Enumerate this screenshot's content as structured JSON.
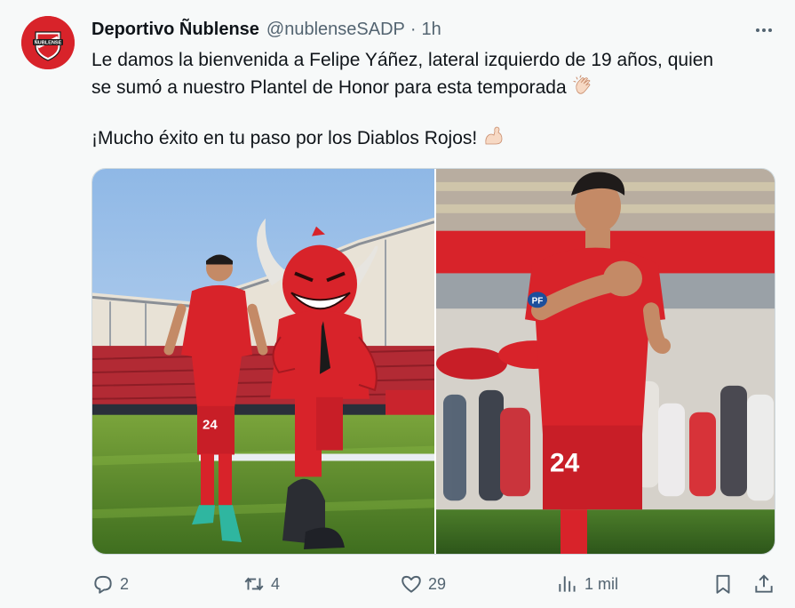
{
  "account": {
    "name": "Deportivo Ñublense",
    "handle": "@nublenseSADP",
    "separator": "·",
    "time": "1h",
    "avatar_text": "ÑUBLENSE"
  },
  "tweet": {
    "line1": "Le damos la bienvenida a Felipe Yáñez, lateral izquierdo de 19 años, quien",
    "line2": "se sumó a nuestro Plantel de Honor para esta temporada",
    "line3": "¡Mucho éxito en tu paso por los Diablos Rojos!",
    "emoji1": "clapping-hands",
    "emoji2": "flexed-biceps"
  },
  "media": {
    "photo1": {
      "jersey_number": "24"
    },
    "photo2": {
      "jersey_number": "24",
      "badge": "PF"
    }
  },
  "actions": {
    "replies": "2",
    "reposts": "4",
    "likes": "29",
    "views": "1 mil"
  },
  "colors": {
    "brand_red": "#d8232a",
    "text": "#0f1419",
    "muted": "#536471",
    "background": "#f7f9f9"
  },
  "icons": [
    "more-icon",
    "reply-icon",
    "repost-icon",
    "like-icon",
    "views-icon",
    "bookmark-icon",
    "share-icon"
  ]
}
